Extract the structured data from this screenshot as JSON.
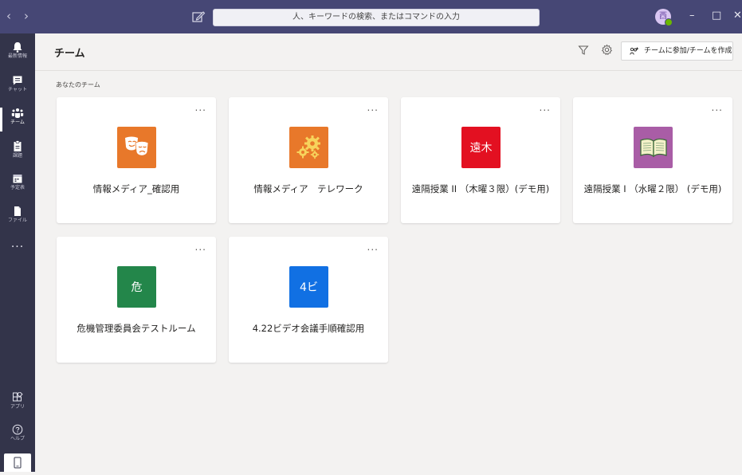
{
  "titlebar": {
    "search_placeholder": "人、キーワードの検索、またはコマンドの入力",
    "avatar_initial": "西"
  },
  "rail": {
    "items": [
      {
        "label": "最新情報",
        "icon": "bell-icon"
      },
      {
        "label": "チャット",
        "icon": "chat-icon"
      },
      {
        "label": "チーム",
        "icon": "teams-icon",
        "active": true
      },
      {
        "label": "課題",
        "icon": "assignments-icon"
      },
      {
        "label": "予定表",
        "icon": "calendar-icon"
      },
      {
        "label": "ファイル",
        "icon": "files-icon"
      }
    ],
    "more": "...",
    "apps_label": "アプリ",
    "help_label": "ヘルプ"
  },
  "header": {
    "title": "チーム",
    "join_button": "チームに参加/チームを作成"
  },
  "section_label": "あなたのチーム",
  "teams": [
    {
      "name": "情報メディア_確認用",
      "tile_type": "theater-masks-icon",
      "tile_color": "#e8782a",
      "tile_text": ""
    },
    {
      "name": "情報メディア　テレワーク",
      "tile_type": "gears-icon",
      "tile_color": "#e8782a",
      "tile_text": ""
    },
    {
      "name": "遠隔授業 II （木曜３限）(デモ用)",
      "tile_type": "text",
      "tile_color": "#e31021",
      "tile_text": "遠木"
    },
    {
      "name": "遠隔授業 I （水曜２限） (デモ用)",
      "tile_type": "book-icon",
      "tile_color": "#a95da6",
      "tile_text": ""
    },
    {
      "name": "危機管理委員会テストルーム",
      "tile_type": "text",
      "tile_color": "#23864a",
      "tile_text": "危"
    },
    {
      "name": "4.22ビデオ会議手順確認用",
      "tile_type": "text",
      "tile_color": "#1170e3",
      "tile_text": "4ビ"
    }
  ],
  "card_more": "..."
}
